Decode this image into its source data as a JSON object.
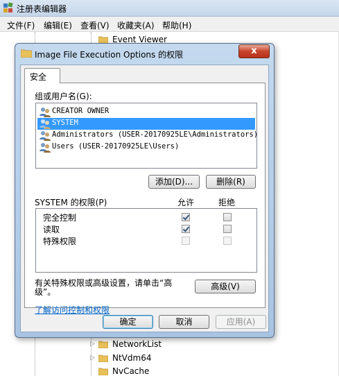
{
  "registry": {
    "title": "注册表编辑器",
    "menu": [
      "文件(F)",
      "编辑(E)",
      "查看(V)",
      "收藏夹(A)",
      "帮助(H)"
    ],
    "tree_top_item": "Event Viewer",
    "tree_bottom_items": [
      "NetworkList",
      "NtVdm64",
      "NvCache"
    ]
  },
  "dialog": {
    "title": "Image File Execution Options 的权限",
    "close_label": "x",
    "tab_label": "安全",
    "users_label": "组或用户名(G):",
    "users": [
      {
        "name": "CREATOR OWNER",
        "selected": false
      },
      {
        "name": "SYSTEM",
        "selected": true
      },
      {
        "name": "Administrators (USER-20170925LE\\Administrators)",
        "selected": false
      },
      {
        "name": "Users (USER-20170925LE\\Users)",
        "selected": false
      }
    ],
    "add_button": "添加(D)...",
    "remove_button": "删除(R)",
    "permissions_label": "SYSTEM 的权限(P)",
    "allow_header": "允许",
    "deny_header": "拒绝",
    "permissions": [
      {
        "name": "完全控制",
        "allow": true,
        "deny": false,
        "enabled": true
      },
      {
        "name": "读取",
        "allow": true,
        "deny": false,
        "enabled": true
      },
      {
        "name": "特殊权限",
        "allow": false,
        "deny": false,
        "enabled": false
      }
    ],
    "advanced_hint": "有关特殊权限或高级设置，请单击“高级”。",
    "advanced_button": "高级(V)",
    "learn_link": "了解访问控制和权限",
    "ok_button": "确定",
    "cancel_button": "取消",
    "apply_button": "应用(A)"
  },
  "colors": {
    "selection": "#3399ff",
    "link": "#0066cc",
    "close_button": "#c7442c"
  }
}
